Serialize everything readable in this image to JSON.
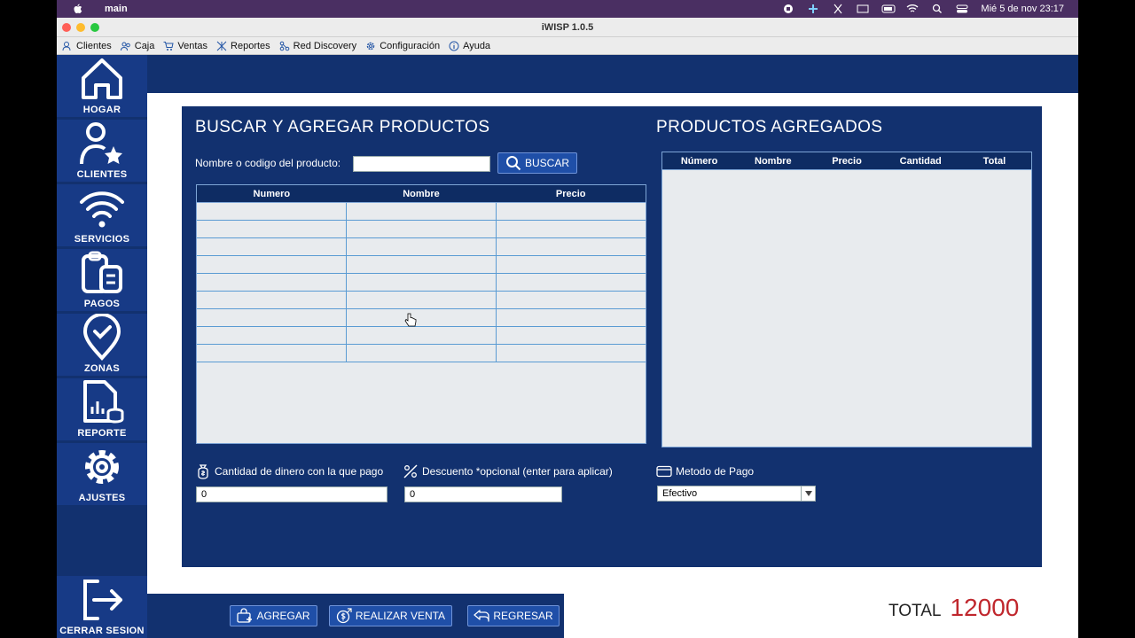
{
  "system_bar": {
    "app_name": "main",
    "datetime": "Mié 5 de nov 23:17"
  },
  "window": {
    "title": "iWISP 1.0.5"
  },
  "menu": [
    {
      "label": "Clientes",
      "icon": "user-icon"
    },
    {
      "label": "Caja",
      "icon": "users-icon"
    },
    {
      "label": "Ventas",
      "icon": "cart-icon"
    },
    {
      "label": "Reportes",
      "icon": "network-icon"
    },
    {
      "label": "Red Discovery",
      "icon": "share-icon"
    },
    {
      "label": "Configuración",
      "icon": "gear-icon"
    },
    {
      "label": "Ayuda",
      "icon": "info-icon"
    }
  ],
  "sidebar": {
    "items": [
      {
        "label": "HOGAR",
        "icon": "home-icon"
      },
      {
        "label": "CLIENTES",
        "icon": "user-star-icon"
      },
      {
        "label": "SERVICIOS",
        "icon": "wifi-icon"
      },
      {
        "label": "PAGOS",
        "icon": "clipboard-icon"
      },
      {
        "label": "ZONAS",
        "icon": "location-check-icon"
      },
      {
        "label": "REPORTE",
        "icon": "report-icon"
      },
      {
        "label": "AJUSTES",
        "icon": "gear-icon"
      }
    ],
    "logout": {
      "label": "CERRAR SESION",
      "icon": "logout-icon"
    }
  },
  "search_section": {
    "title": "BUSCAR Y AGREGAR  PRODUCTOS",
    "search_label": "Nombre o codigo del producto:",
    "search_value": "",
    "search_button": "BUSCAR",
    "columns": [
      "Numero",
      "Nombre",
      "Precio"
    ],
    "row_count": 9
  },
  "added_section": {
    "title": "PRODUCTOS AGREGADOS",
    "columns": [
      "Número",
      "Nombre",
      "Precio",
      "Cantidad",
      "Total"
    ]
  },
  "payment": {
    "amount_label": "Cantidad de dinero con la que pago",
    "amount_value": "0",
    "discount_label": "Descuento *opcional (enter para aplicar)",
    "discount_value": "0",
    "method_label": "Metodo de Pago",
    "method_value": "Efectivo"
  },
  "actions": {
    "add": "AGREGAR",
    "sell": "REALIZAR VENTA",
    "back": "REGRESAR"
  },
  "total": {
    "label": "TOTAL",
    "value": "12000"
  }
}
